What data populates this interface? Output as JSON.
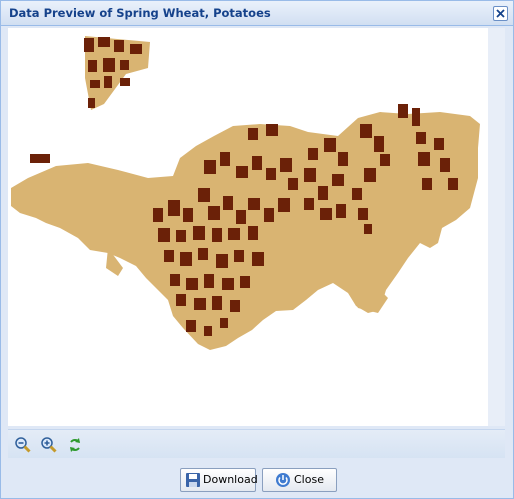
{
  "window": {
    "title": "Data Preview of Spring Wheat, Potatoes"
  },
  "colors": {
    "title_text": "#15428b",
    "potatoes": "#6b2108",
    "spring_wheat": "#d9b472",
    "panel_bg": "#dfe8f6",
    "map_bg": "#ffffff"
  },
  "toolbar": {
    "icons": [
      "zoom-out-icon",
      "zoom-in-icon",
      "refresh-icon"
    ]
  },
  "buttons": {
    "download_label": "Download",
    "close_label": "Close"
  }
}
